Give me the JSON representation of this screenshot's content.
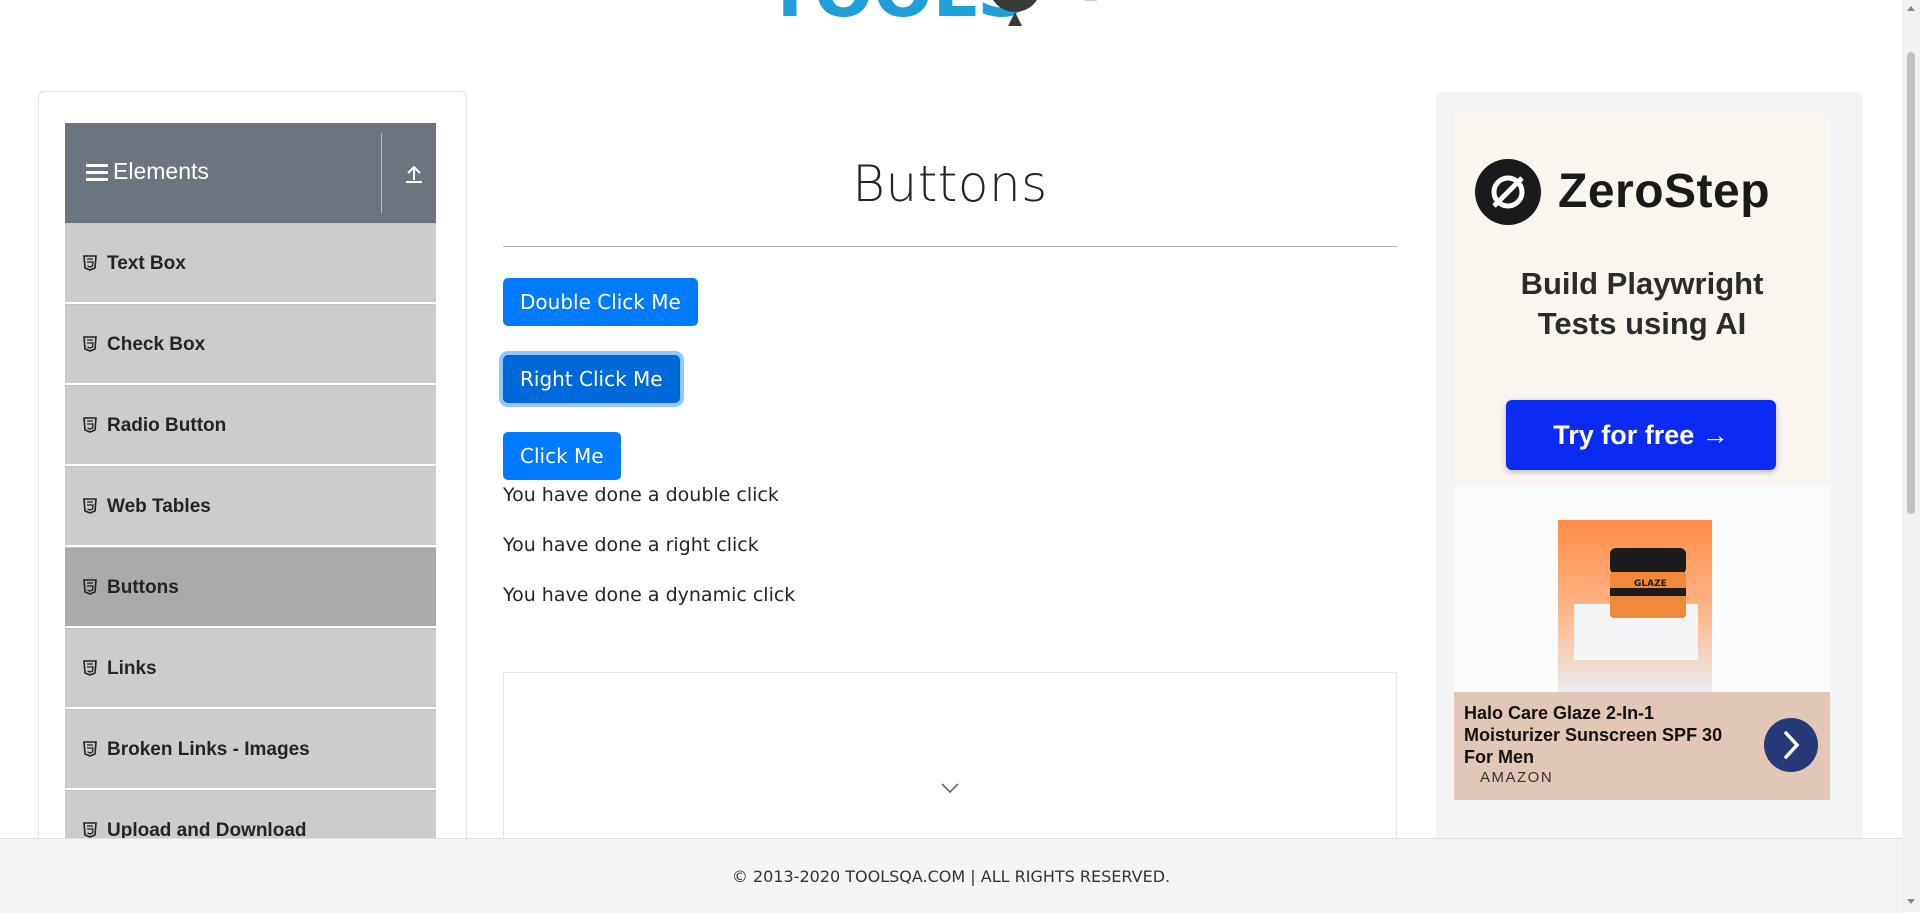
{
  "header": {
    "logo_alt": "TOOLSQA"
  },
  "sidebar": {
    "group_title": "Elements",
    "items": [
      {
        "label": "Text Box"
      },
      {
        "label": "Check Box"
      },
      {
        "label": "Radio Button"
      },
      {
        "label": "Web Tables"
      },
      {
        "label": "Buttons",
        "active": true
      },
      {
        "label": "Links"
      },
      {
        "label": "Broken Links - Images"
      },
      {
        "label": "Upload and Download"
      }
    ]
  },
  "main": {
    "title": "Buttons",
    "buttons": {
      "double_click": "Double Click Me",
      "right_click": "Right Click Me",
      "click": "Click Me"
    },
    "messages": {
      "double": "You have done a double click",
      "right": "You have done a right click",
      "dynamic": "You have done a dynamic click"
    }
  },
  "ad": {
    "brand": "ZeroStep",
    "tagline_line1": "Build Playwright",
    "tagline_line2": "Tests using AI",
    "cta": "Try for free →",
    "product_name": "Halo Care Glaze 2-In-1 Moisturizer Sunscreen SPF 30 For Men",
    "product_source": "AMAZON",
    "jar_label": "GLAZE"
  },
  "footer": {
    "text": "© 2013-2020 TOOLSQA.COM | ALL RIGHTS RESERVED."
  },
  "colors": {
    "primary": "#007bff",
    "sidebar_header": "#6c757d",
    "menu_item": "#cccccc",
    "menu_active": "#aaaaaa",
    "ad_cta": "#0b2bf2"
  }
}
